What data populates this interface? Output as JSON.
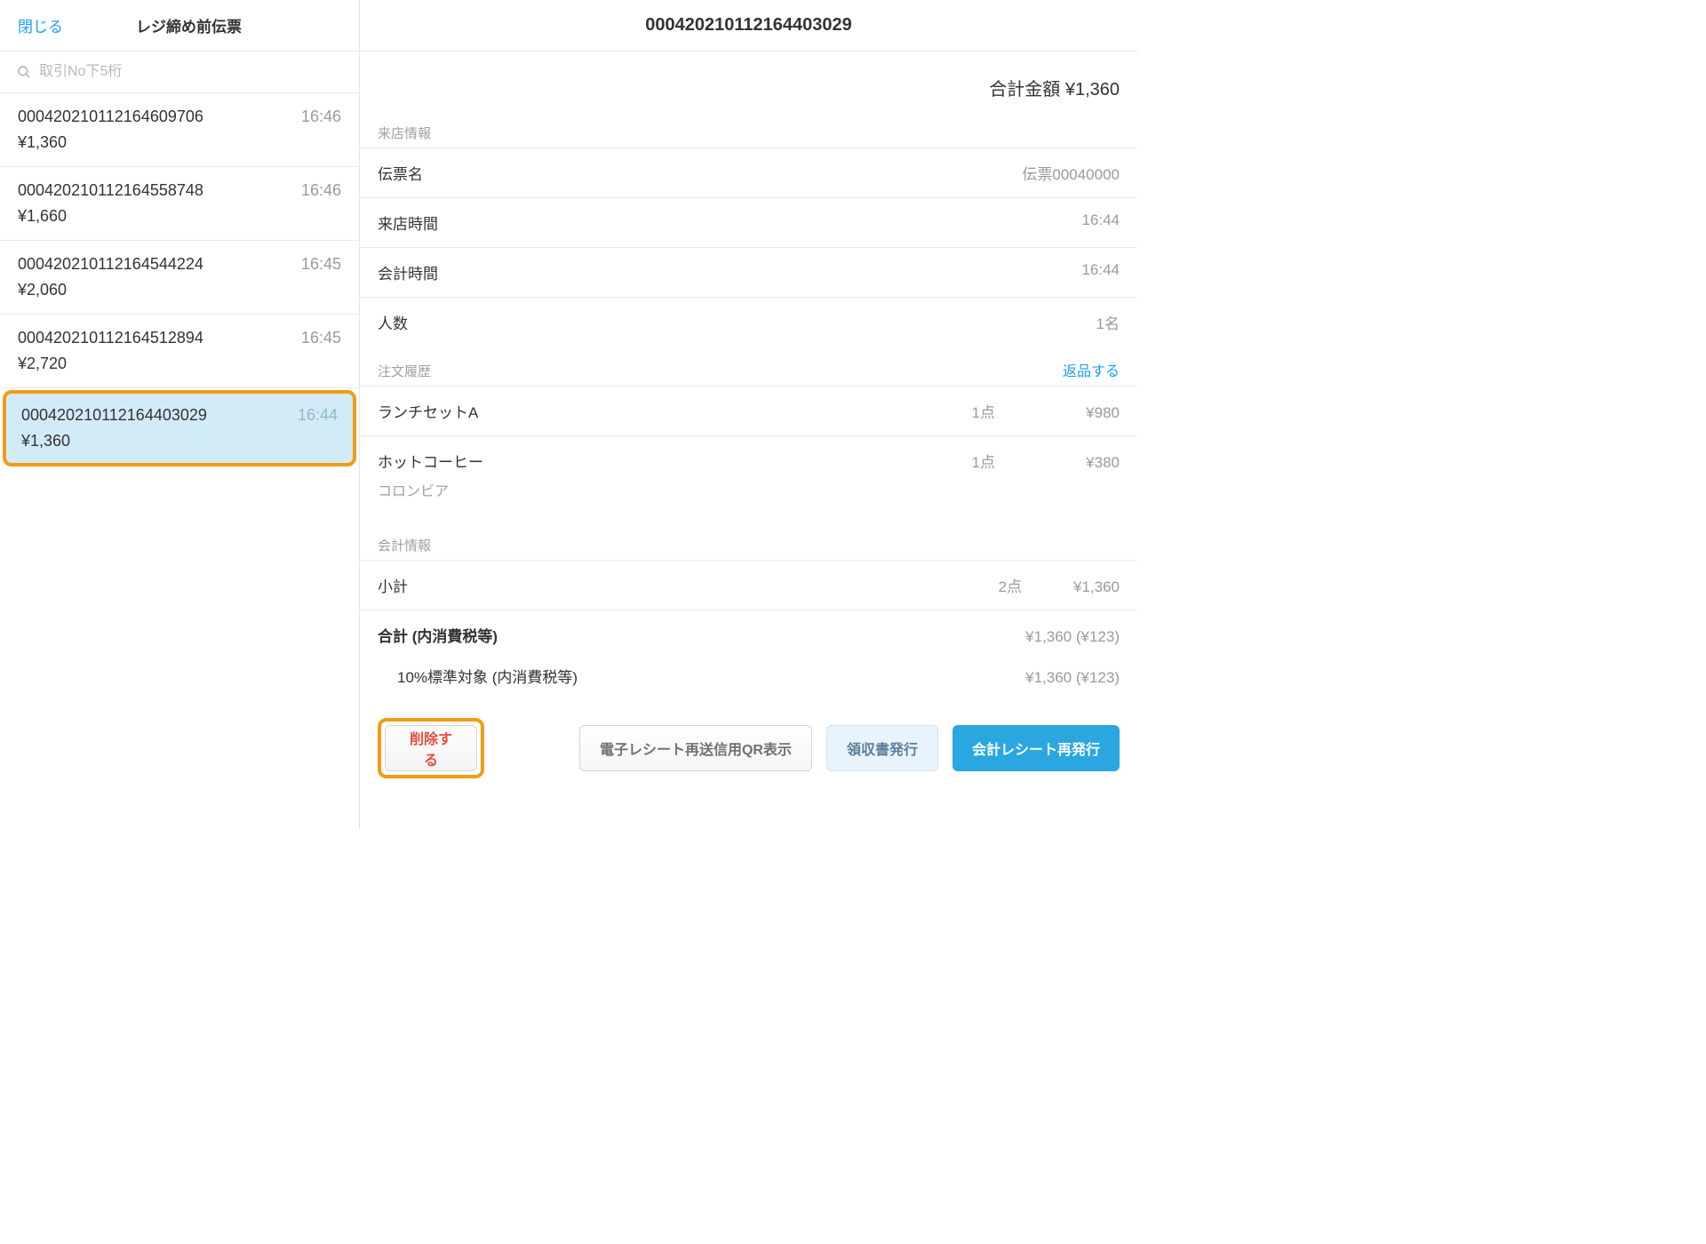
{
  "sidebar": {
    "close_label": "閉じる",
    "title": "レジ締め前伝票",
    "search_placeholder": "取引No下5桁",
    "transactions": [
      {
        "id": "000420210112164609706",
        "time": "16:46",
        "amount": "¥1,360"
      },
      {
        "id": "000420210112164558748",
        "time": "16:46",
        "amount": "¥1,660"
      },
      {
        "id": "000420210112164544224",
        "time": "16:45",
        "amount": "¥2,060"
      },
      {
        "id": "000420210112164512894",
        "time": "16:45",
        "amount": "¥2,720"
      },
      {
        "id": "000420210112164403029",
        "time": "16:44",
        "amount": "¥1,360"
      }
    ]
  },
  "detail": {
    "header_id": "000420210112164403029",
    "total_label": "合計金額 ¥1,360",
    "visit_section": "来店情報",
    "visit": {
      "slip_label": "伝票名",
      "slip_value": "伝票00040000",
      "visit_time_label": "来店時間",
      "visit_time_value": "16:44",
      "checkout_time_label": "会計時間",
      "checkout_time_value": "16:44",
      "people_label": "人数",
      "people_value": "1名"
    },
    "order_section": "注文履歴",
    "return_label": "返品する",
    "orders": [
      {
        "name": "ランチセットA",
        "qty": "1点",
        "price": "¥980",
        "sub": ""
      },
      {
        "name": "ホットコーヒー",
        "qty": "1点",
        "price": "¥380",
        "sub": "コロンビア"
      }
    ],
    "payment_section": "会計情報",
    "payment": {
      "subtotal_label": "小計",
      "subtotal_qty": "2点",
      "subtotal_value": "¥1,360",
      "total_label": "合計 (内消費税等)",
      "total_value": "¥1,360 (¥123)",
      "tax_label": "10%標準対象 (内消費税等)",
      "tax_value": "¥1,360 (¥123)"
    },
    "actions": {
      "delete": "削除する",
      "qr": "電子レシート再送信用QR表示",
      "receipt": "領収書発行",
      "reissue": "会計レシート再発行"
    }
  }
}
